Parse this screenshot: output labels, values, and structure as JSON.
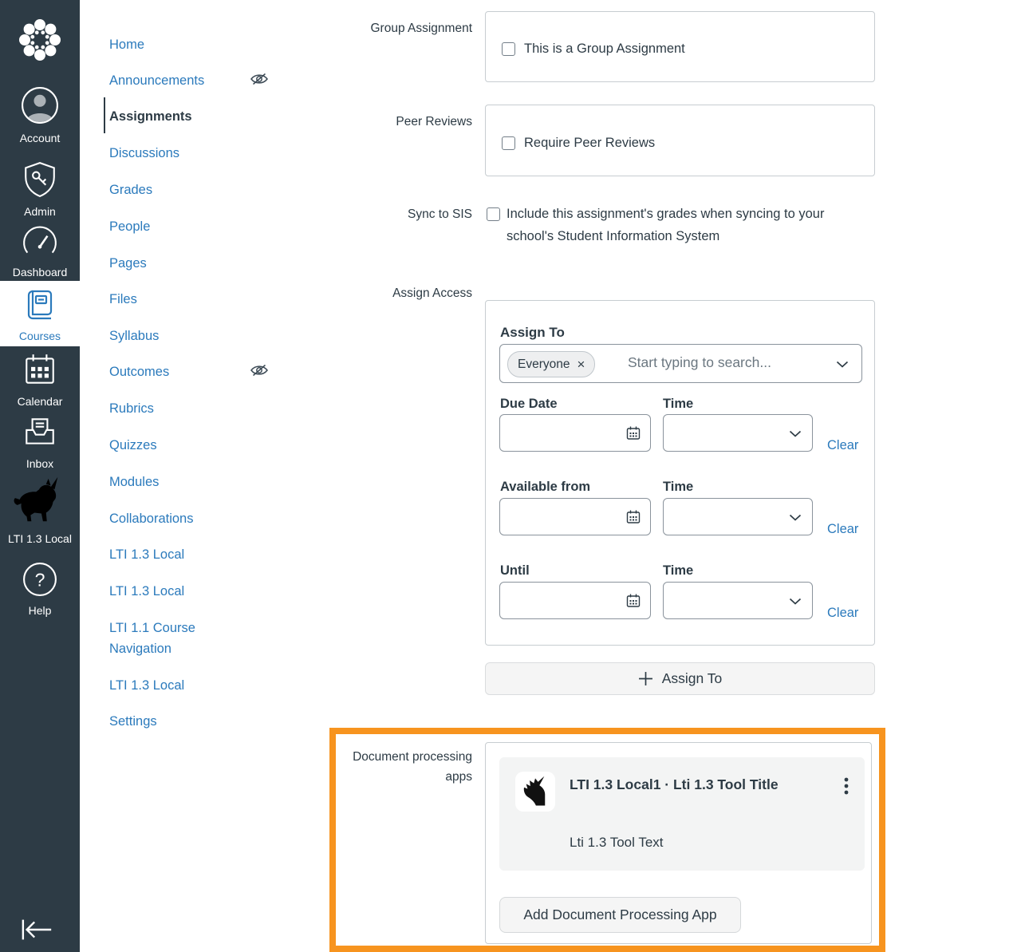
{
  "colors": {
    "sidebar_bg": "#2D3B45",
    "link_blue": "#2B7ABC",
    "text_dark": "#2D3B45",
    "highlight_orange": "#F7941F",
    "box_border": "#C7CDD1"
  },
  "global_nav": {
    "items": [
      {
        "label": "Account",
        "icon": "avatar-icon"
      },
      {
        "label": "Admin",
        "icon": "shield-key-icon"
      },
      {
        "label": "Dashboard",
        "icon": "gauge-icon"
      },
      {
        "label": "Courses",
        "icon": "book-icon",
        "active": true
      },
      {
        "label": "Calendar",
        "icon": "calendar-icon"
      },
      {
        "label": "Inbox",
        "icon": "inbox-icon"
      },
      {
        "label": "LTI 1.3 Local",
        "icon": "unicorn-icon"
      },
      {
        "label": "Help",
        "icon": "help-icon"
      }
    ],
    "collapse_icon": "collapse-sidebar-icon"
  },
  "course_nav": {
    "items": [
      {
        "label": "Home"
      },
      {
        "label": "Announcements",
        "hidden_icon": true
      },
      {
        "label": "Assignments",
        "active": true
      },
      {
        "label": "Discussions"
      },
      {
        "label": "Grades"
      },
      {
        "label": "People"
      },
      {
        "label": "Pages"
      },
      {
        "label": "Files"
      },
      {
        "label": "Syllabus"
      },
      {
        "label": "Outcomes",
        "hidden_icon": true
      },
      {
        "label": "Rubrics"
      },
      {
        "label": "Quizzes"
      },
      {
        "label": "Modules"
      },
      {
        "label": "Collaborations"
      },
      {
        "label": "LTI 1.3 Local"
      },
      {
        "label": "LTI 1.3 Local"
      },
      {
        "label": "LTI 1.1 Course Navigation"
      },
      {
        "label": "LTI 1.3 Local"
      },
      {
        "label": "Settings"
      }
    ]
  },
  "form": {
    "group_assignment": {
      "label": "Group Assignment",
      "checkbox": "This is a Group Assignment",
      "checked": false
    },
    "peer_reviews": {
      "label": "Peer Reviews",
      "checkbox": "Require Peer Reviews",
      "checked": false
    },
    "sync_to_sis": {
      "label": "Sync to SIS",
      "checkbox": "Include this assignment's grades when syncing to your school's Student Information System",
      "checked": false
    },
    "assign_access": {
      "label": "Assign Access",
      "assign_to_heading": "Assign To",
      "selected_tag": "Everyone",
      "remove_tag_symbol": "×",
      "search_placeholder": "Start typing to search...",
      "rows": [
        {
          "date_label": "Due Date",
          "date_value": "",
          "time_label": "Time",
          "time_value": "",
          "clear_label": "Clear"
        },
        {
          "date_label": "Available from",
          "date_value": "",
          "time_label": "Time",
          "time_value": "",
          "clear_label": "Clear"
        },
        {
          "date_label": "Until",
          "date_value": "",
          "time_label": "Time",
          "time_value": "",
          "clear_label": "Clear"
        }
      ],
      "add_assign_to_button": "Assign To"
    },
    "document_processing": {
      "label": "Document processing apps",
      "card": {
        "title": "LTI 1.3 Local1 · Lti 1.3 Tool Title",
        "description": "Lti 1.3 Tool Text"
      },
      "add_button": "Add Document Processing App"
    }
  }
}
